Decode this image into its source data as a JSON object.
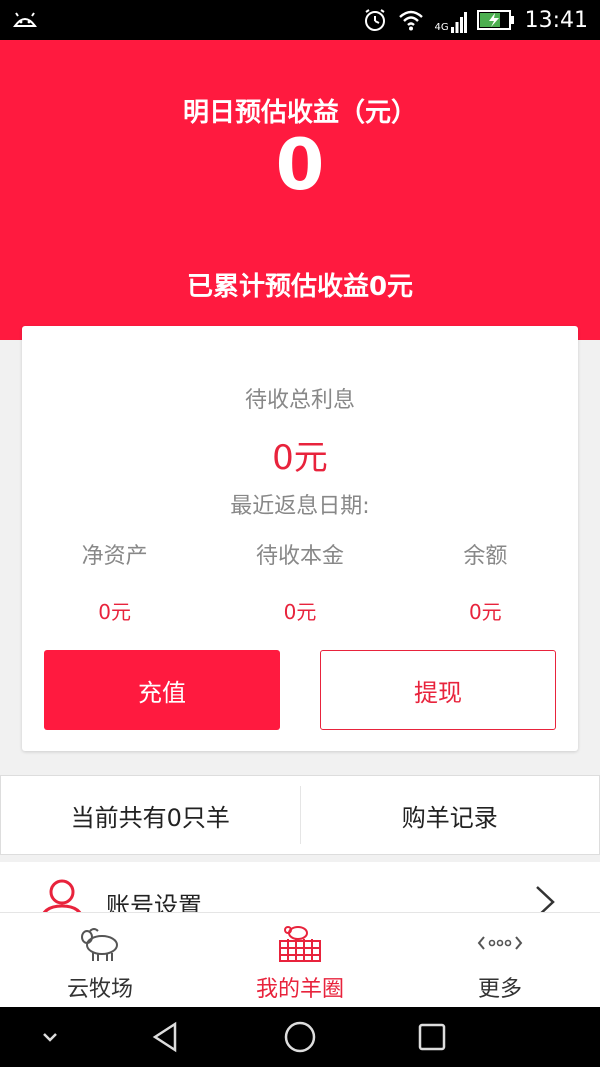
{
  "status_bar": {
    "time": "13:41",
    "network": "4G"
  },
  "header": {
    "tomorrow_label": "明日预估收益（元）",
    "tomorrow_value": "0",
    "cumulative": "已累计预估收益0元"
  },
  "card": {
    "pending_interest_label": "待收总利息",
    "pending_interest_value": "0元",
    "recent_date_label": "最近返息日期:",
    "columns": [
      {
        "label": "净资产",
        "value": "0元"
      },
      {
        "label": "待收本金",
        "value": "0元"
      },
      {
        "label": "余额",
        "value": "0元"
      }
    ],
    "recharge_label": "充值",
    "withdraw_label": "提现"
  },
  "records": {
    "sheep_count": "当前共有0只羊",
    "purchase_records": "购羊记录"
  },
  "account": {
    "label": "账号设置"
  },
  "tabs": [
    {
      "label": "云牧场",
      "icon": "sheep-icon"
    },
    {
      "label": "我的羊圈",
      "icon": "sheepfold-icon",
      "active": true
    },
    {
      "label": "更多",
      "icon": "more-icon"
    }
  ],
  "colors": {
    "brand_red": "#ff1a3f",
    "accent_red": "#e8233c"
  }
}
